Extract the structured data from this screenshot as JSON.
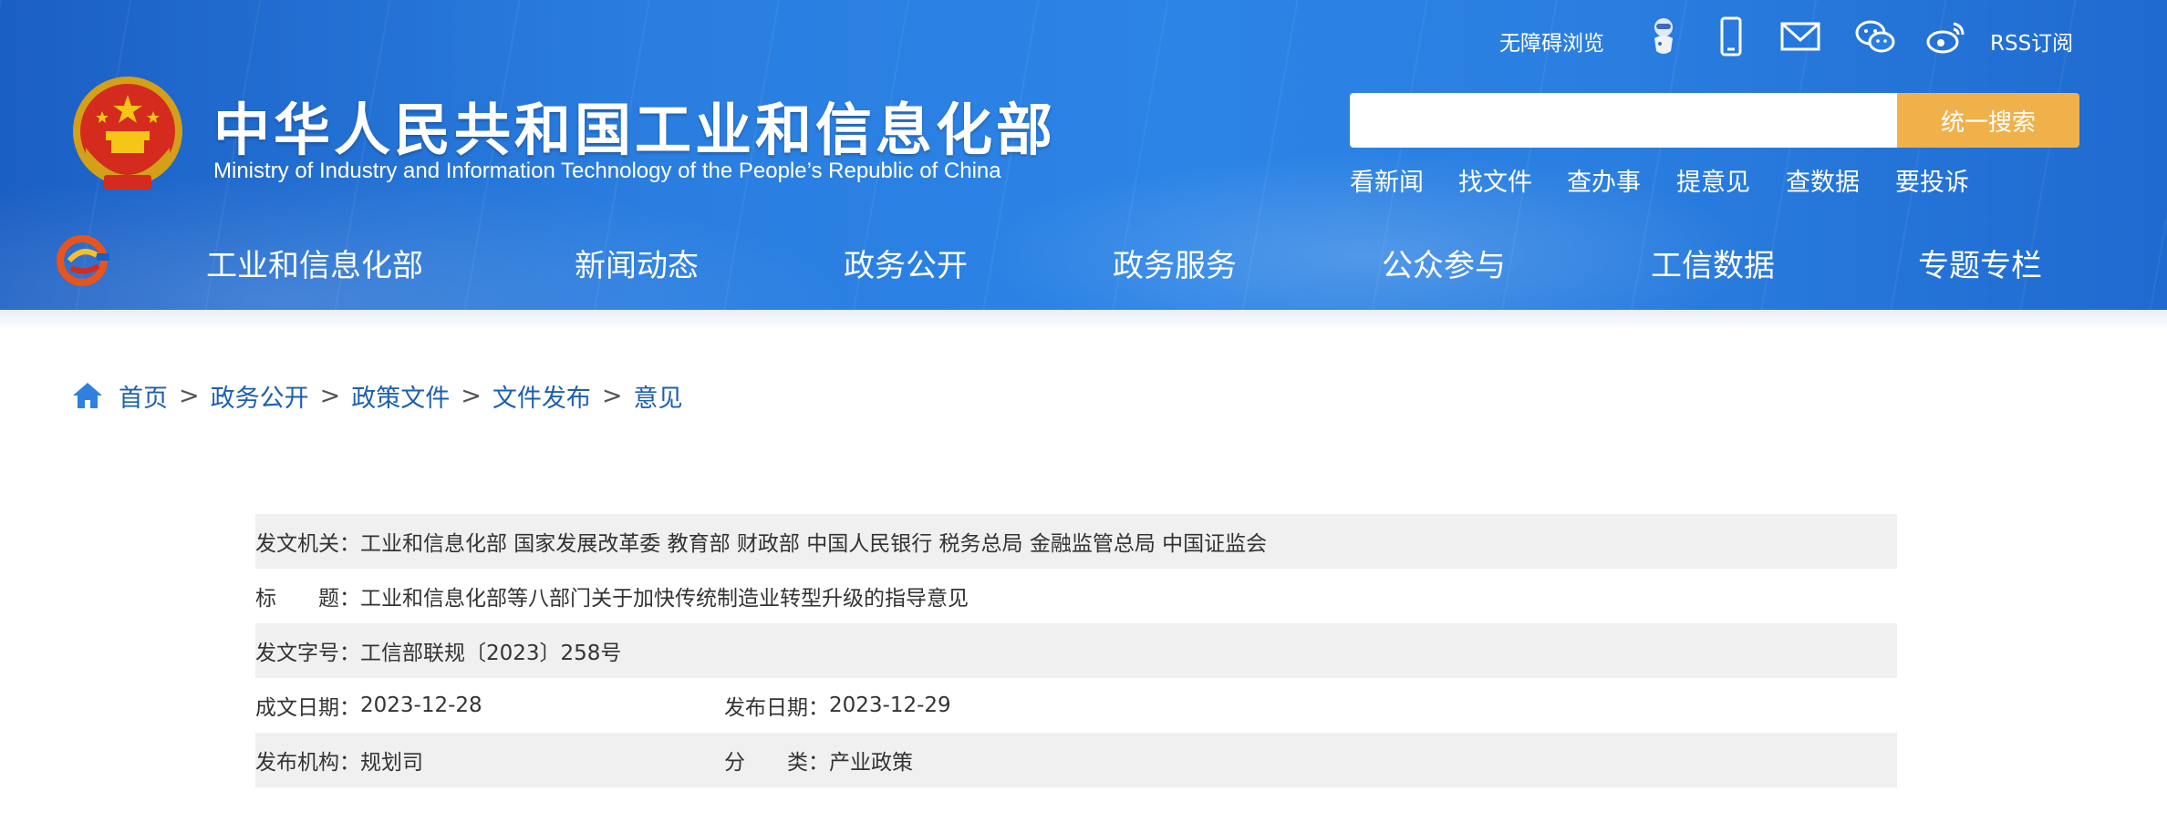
{
  "header": {
    "title_cn": "中华人民共和国工业和信息化部",
    "title_en": "Ministry of Industry and Information Technology of the People’s Republic of China",
    "accessibility_label": "无障碍浏览",
    "rss_label": "RSS订阅",
    "search_button_label": "统一搜索",
    "search_placeholder": "",
    "quick_links": [
      "看新闻",
      "找文件",
      "查办事",
      "提意见",
      "查数据",
      "要投诉"
    ]
  },
  "nav": {
    "items": [
      "工业和信息化部",
      "新闻动态",
      "政务公开",
      "政务服务",
      "公众参与",
      "工信数据",
      "专题专栏"
    ]
  },
  "breadcrumb": {
    "items": [
      "首页",
      "政务公开",
      "政策文件",
      "文件发布",
      "意见"
    ],
    "separator": ">"
  },
  "meta": {
    "issuer_label": "发文机关：",
    "issuer_value": "工业和信息化部 国家发展改革委 教育部 财政部 中国人民银行 税务总局 金融监管总局 中国证监会",
    "title_label": "标　　题：",
    "title_value": "工业和信息化部等八部门关于加快传统制造业转型升级的指导意见",
    "doc_no_label": "发文字号：",
    "doc_no_value": "工信部联规〔2023〕258号",
    "created_label": "成文日期：",
    "created_value": "2023-12-28",
    "published_label": "发布日期：",
    "published_value": "2023-12-29",
    "agency_label": "发布机构：",
    "agency_value": "规划司",
    "category_label": "分　　类：",
    "category_value": "产业政策"
  },
  "colors": {
    "header_blue": "#2a7ee0",
    "search_orange": "#f0b14b",
    "breadcrumb_blue": "#1d5fb0",
    "row_shade": "#f0f0f0"
  }
}
